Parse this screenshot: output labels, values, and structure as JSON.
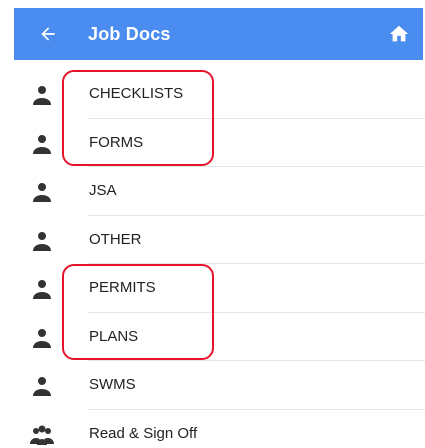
{
  "appbar": {
    "title": "Job Docs",
    "back_icon": "arrow-left-icon",
    "home_icon": "home-icon",
    "color": "#4a8cf0"
  },
  "list": {
    "items": [
      {
        "label": "CHECKLISTS",
        "icon": "person-icon"
      },
      {
        "label": "FORMS",
        "icon": "person-icon"
      },
      {
        "label": "JSA",
        "icon": "person-icon"
      },
      {
        "label": "OTHER",
        "icon": "person-icon"
      },
      {
        "label": "PERMITS",
        "icon": "person-icon"
      },
      {
        "label": "PLANS",
        "icon": "person-icon"
      },
      {
        "label": "SWMS",
        "icon": "person-icon"
      },
      {
        "label": "Read & Sign Off",
        "icon": "group-icon"
      }
    ]
  },
  "annotations": {
    "highlight_color": "#e5142a"
  }
}
